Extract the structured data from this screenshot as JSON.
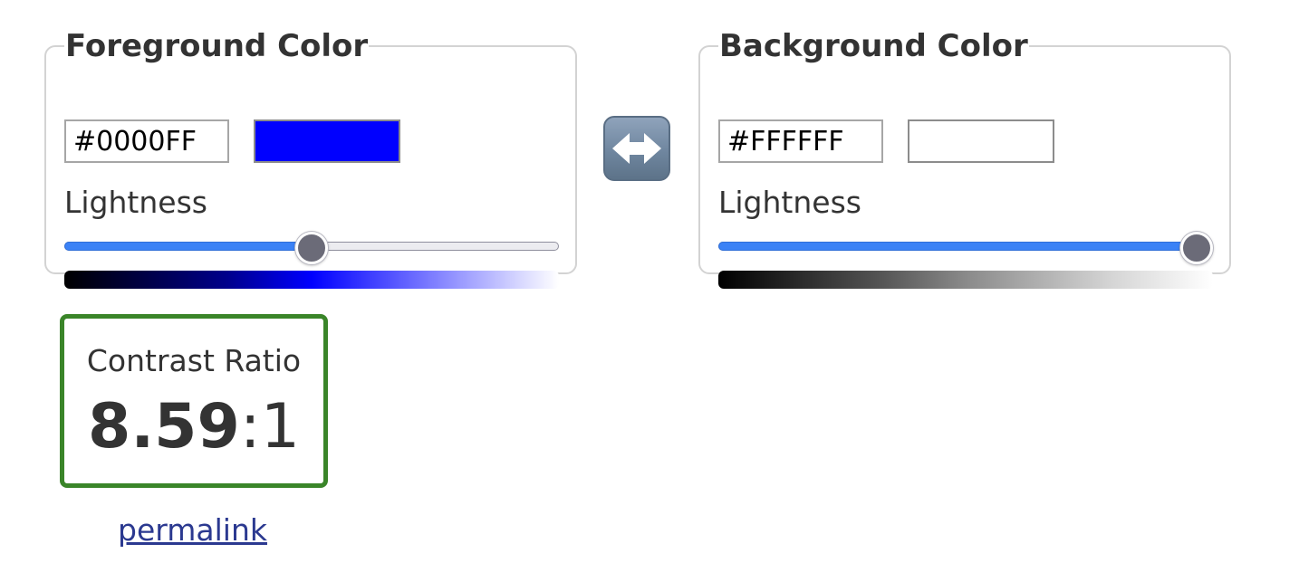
{
  "foreground": {
    "legend": "Foreground Color",
    "hex_value": "#0000FF",
    "swatch_color": "#0000FF",
    "lightness_label": "Lightness",
    "lightness_fraction": 0.5
  },
  "background": {
    "legend": "Background Color",
    "hex_value": "#FFFFFF",
    "swatch_color": "#FFFFFF",
    "lightness_label": "Lightness",
    "lightness_fraction": 1.0
  },
  "swap": {
    "icon": "left-right-arrow-icon"
  },
  "contrast": {
    "title": "Contrast Ratio",
    "ratio": "8.59",
    "separator": ":",
    "suffix": "1",
    "border_color": "#3A8529"
  },
  "permalink": {
    "label": "permalink"
  }
}
